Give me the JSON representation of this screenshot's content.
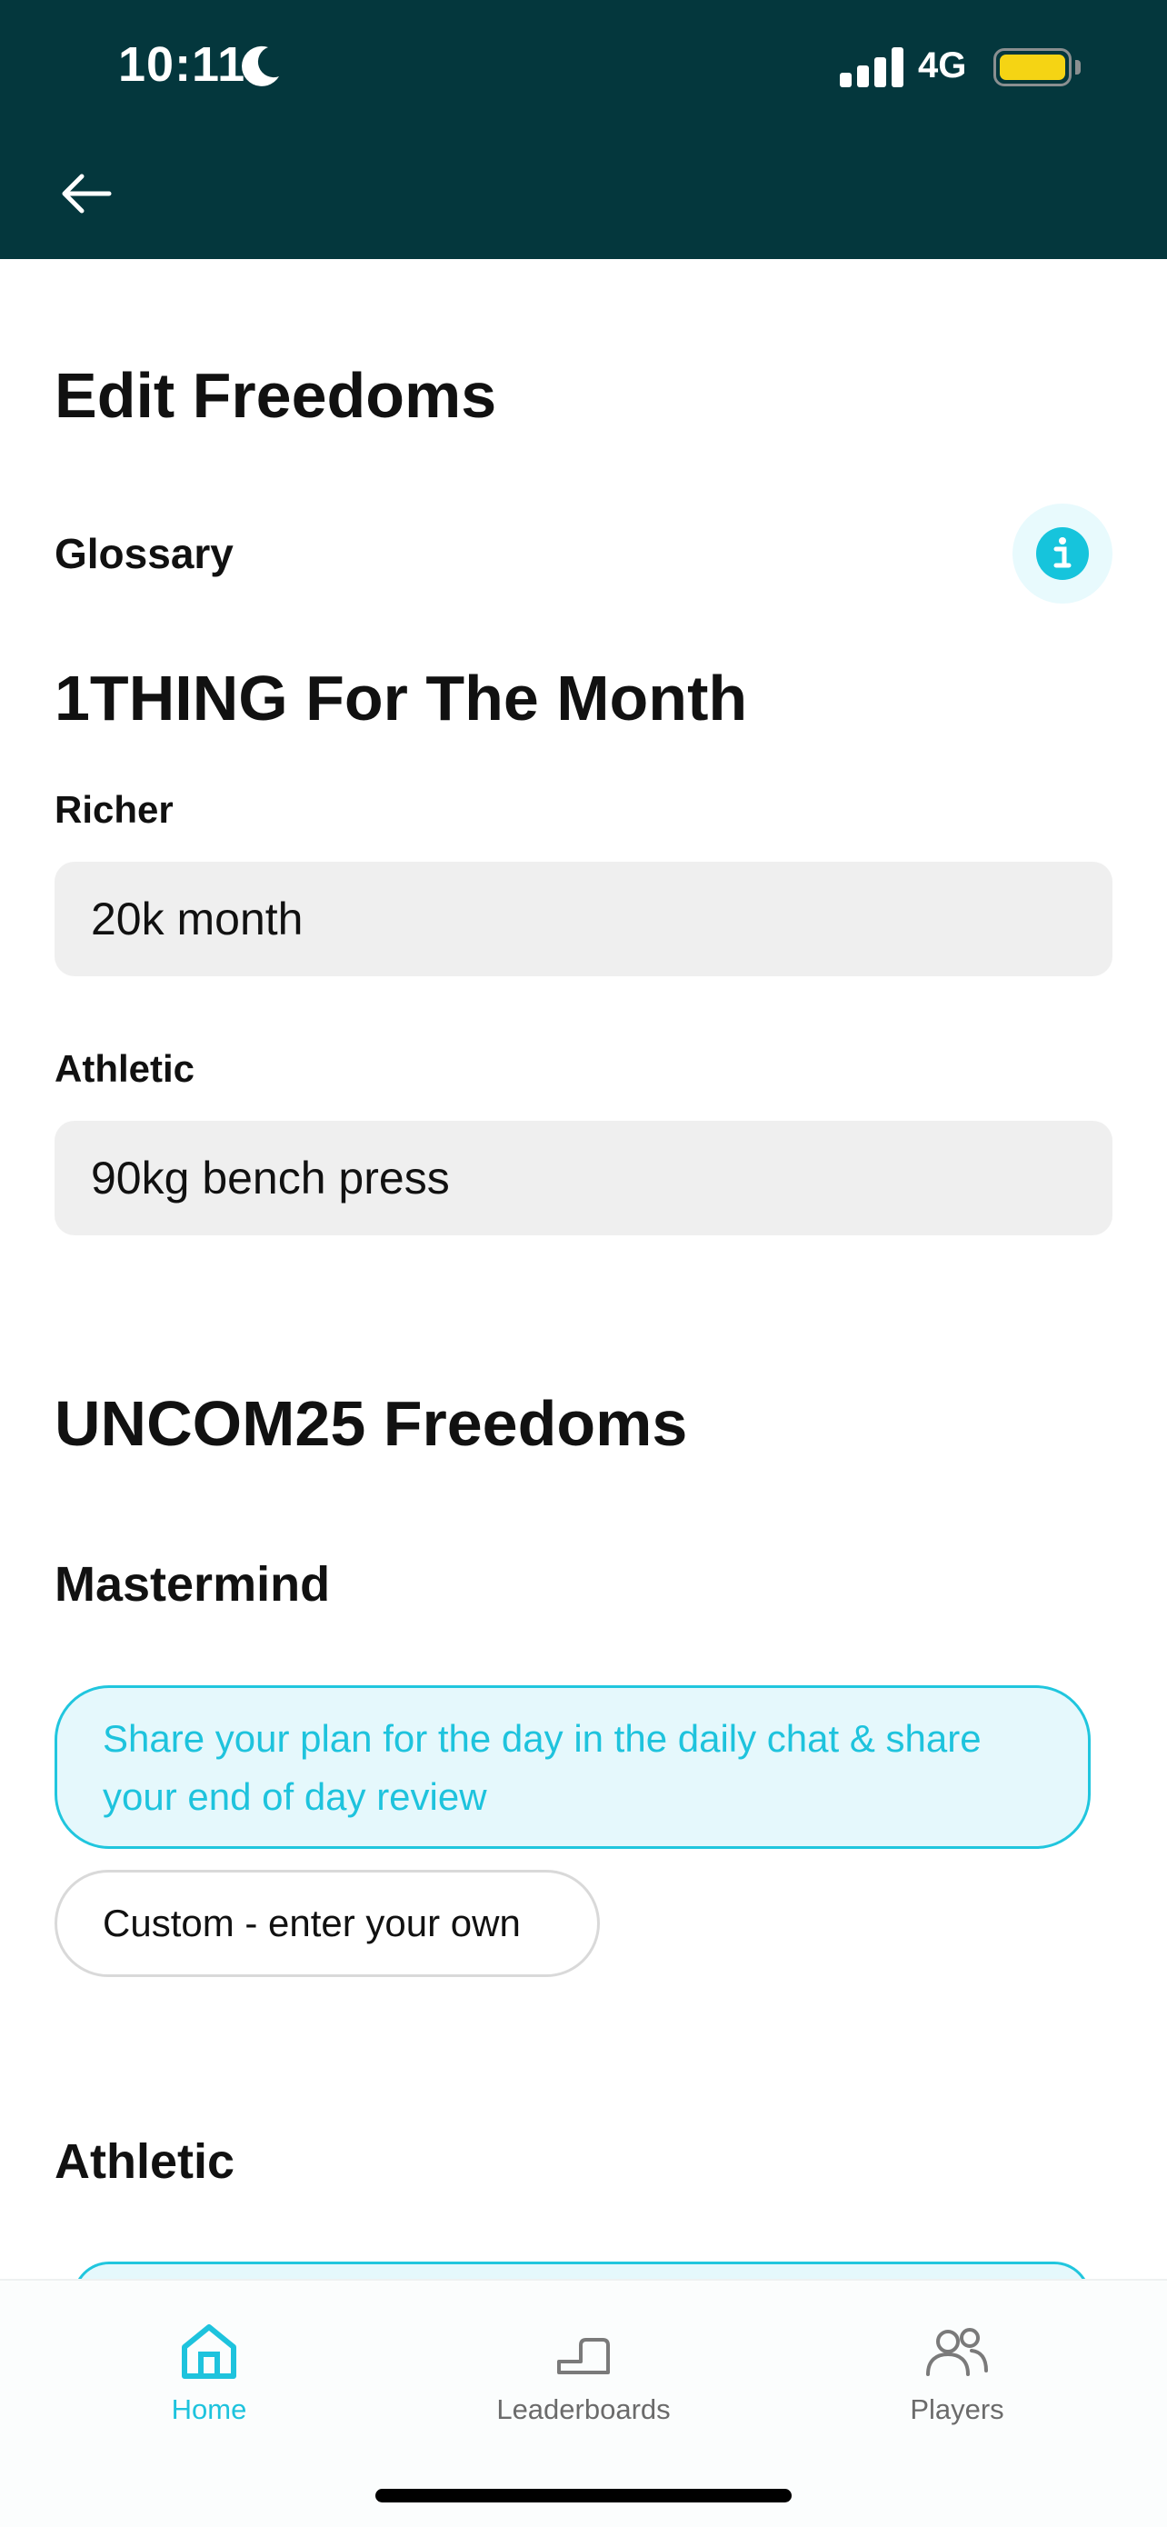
{
  "status_bar": {
    "time": "10:11",
    "network": "4G",
    "battery_color": "#f5d414"
  },
  "header": {
    "background": "#04373d",
    "back_icon": "arrow-left-icon"
  },
  "page": {
    "title": "Edit Freedoms",
    "glossary_label": "Glossary",
    "info_icon": "info-icon"
  },
  "one_thing": {
    "heading": "1THING For The Month",
    "fields": [
      {
        "label": "Richer",
        "value": "20k month"
      },
      {
        "label": "Athletic",
        "value": "90kg bench press"
      }
    ]
  },
  "freedoms": {
    "heading": "UNCOM25 Freedoms",
    "groups": [
      {
        "title": "Mastermind",
        "options": [
          {
            "label": "Share your plan for the day in the daily chat & share your end of day review",
            "selected": true
          },
          {
            "label": "Custom - enter your own",
            "selected": false
          }
        ]
      },
      {
        "title": "Athletic"
      }
    ]
  },
  "tabs": [
    {
      "label": "Home",
      "icon": "home-icon",
      "active": true
    },
    {
      "label": "Leaderboards",
      "icon": "stairs-icon",
      "active": false
    },
    {
      "label": "Players",
      "icon": "users-icon",
      "active": false
    }
  ],
  "colors": {
    "accent": "#1ec3dd",
    "accent_bg": "#e5f8fc",
    "field_bg": "#efefef",
    "inactive_tab": "#7a7a7a"
  }
}
